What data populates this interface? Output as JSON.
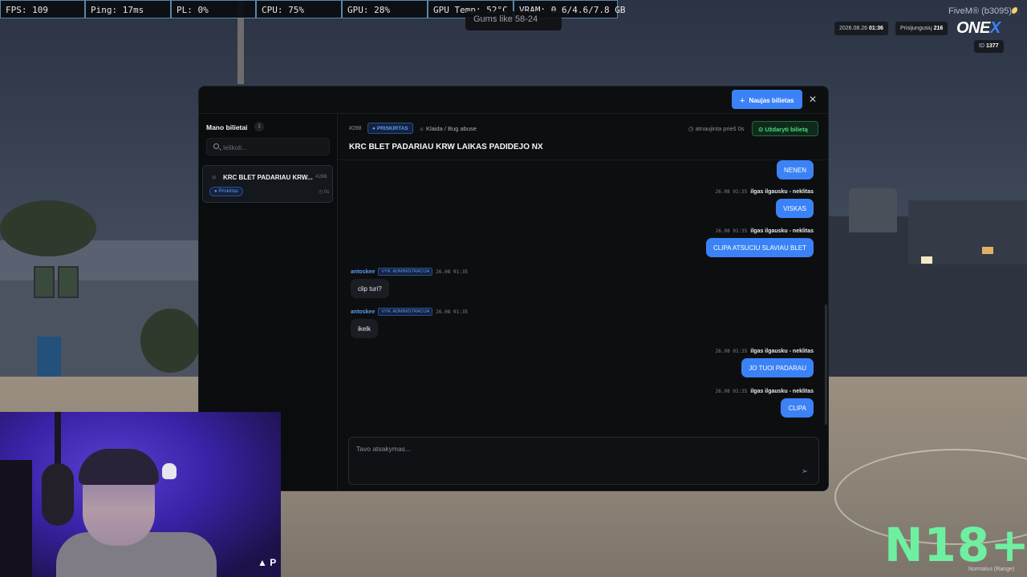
{
  "stats_bar": {
    "fps": "FPS: 109",
    "ping": "Ping: 17ms",
    "pl": "PL: 0%",
    "cpu": "CPU: 75%",
    "gpu": "GPU: 28%",
    "gpu_temp": "GPU Temp: 52°C",
    "vram": "VRAM: 0.6/4.6/7.8 GB"
  },
  "notification": "Gums like 58-24",
  "hud": {
    "fivem_label": "FiveM® (b3095)",
    "date": "2026.08.26",
    "time": "01:36",
    "online_label": "Prisijungusių",
    "online_count": "216",
    "brand_main": "ONE",
    "brand_accent": "X",
    "id_label": "ID",
    "id_value": "1377"
  },
  "modal": {
    "new_ticket_label": "Naujas bilietas",
    "close_symbol": "✕",
    "sidebar": {
      "title": "Mano bilietai",
      "count": "1",
      "search_placeholder": "Ieškoti...",
      "tickets": [
        {
          "title": "KRC BLET PADARIAU KRW...",
          "number": "#288",
          "status": "● Priskirtas",
          "time": "0s"
        }
      ]
    },
    "ticket": {
      "number": "#288",
      "status": "● PRISKIRTAS",
      "category": "Klaida / Bug abuse",
      "updated": "atnaujinta prieš 0s",
      "close_label": "Uždaryti bilietą",
      "title": "KRC BLET PADARIAU KRW LAIKAS PADIDEJO NX"
    },
    "messages": [
      {
        "side": "right",
        "text": "NENEN"
      },
      {
        "side": "right",
        "time": "26.08 01:35",
        "author": "ilgas ilgausku - neklitas",
        "text": "VISKAS"
      },
      {
        "side": "right",
        "time": "26.08 01:35",
        "author": "ilgas ilgausku - neklitas",
        "text": "CLIPA ATSUCIU SLAVIAU BLET"
      },
      {
        "side": "left",
        "author": "antoskee",
        "role": "VYR. ADMINISTRACIJA",
        "time": "26.08 01:35",
        "text": "clip turi?"
      },
      {
        "side": "left",
        "author": "antoskee",
        "role": "VYR. ADMINISTRACIJA",
        "time": "26.08 01:35",
        "text": "ikelk"
      },
      {
        "side": "right",
        "time": "26.08 01:35",
        "author": "ilgas ilgausku - neklitas",
        "text": "JO TUOI PADARAU"
      },
      {
        "side": "right",
        "time": "26.08 01:35",
        "author": "ilgas ilgausku - neklitas",
        "text": "CLIPA"
      }
    ],
    "reply_placeholder": "Tavo atsakymas..."
  },
  "overlay": {
    "n18": "N18+",
    "mode": "Normalus (Range)",
    "webcam_logo": "P"
  },
  "colors": {
    "accent": "#3b82f6",
    "success": "#4ade80",
    "panel_bg": "#0d0e10"
  }
}
